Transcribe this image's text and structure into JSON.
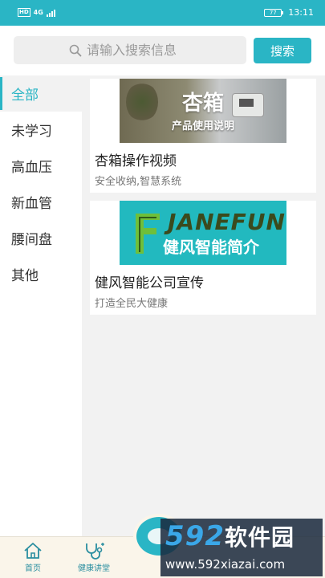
{
  "status_bar": {
    "left_label": "HD",
    "network": "4G",
    "battery": "77",
    "time": "13:11"
  },
  "search": {
    "placeholder": "请输入搜索信息",
    "button_label": "搜索"
  },
  "sidebar": {
    "items": [
      {
        "label": "全部",
        "active": true
      },
      {
        "label": "未学习",
        "active": false
      },
      {
        "label": "高血压",
        "active": false
      },
      {
        "label": "新血管",
        "active": false
      },
      {
        "label": "腰间盘",
        "active": false
      },
      {
        "label": "其他",
        "active": false
      }
    ]
  },
  "cards": [
    {
      "thumb_title": "杏箱",
      "thumb_subtitle": "产品使用说明",
      "title": "杏箱操作视频",
      "subtitle": "安全收纳,智慧系统"
    },
    {
      "thumb_brand": "JANEFUN",
      "thumb_brand_cn": "健风智能简介",
      "title": "健风智能公司宣传",
      "subtitle": "打造全民大健康"
    }
  ],
  "tabbar": {
    "tabs": [
      {
        "label": "首页",
        "icon": "home-icon"
      },
      {
        "label": "健康讲堂",
        "icon": "stethoscope-icon"
      }
    ]
  },
  "watermark": {
    "brand": "592",
    "brand_cn": "软件园",
    "url": "www.592xiazai.com"
  },
  "colors": {
    "accent": "#2ab5c5",
    "background": "#f2f2f2",
    "tabbar_bg": "#faf5ea"
  }
}
